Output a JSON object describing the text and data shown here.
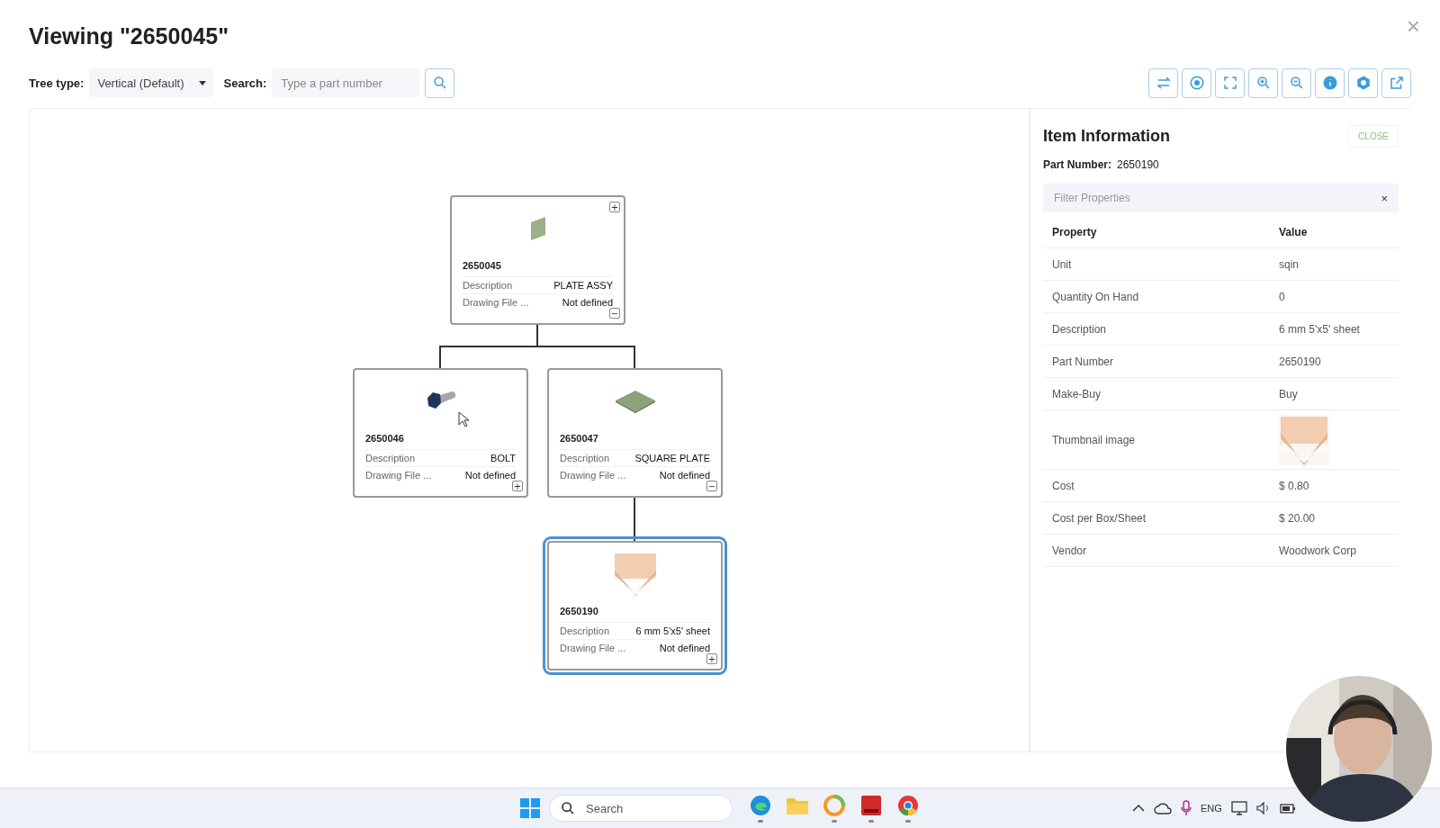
{
  "title": "Viewing \"2650045\"",
  "close_symbol": "×",
  "toolbar": {
    "tree_type_label": "Tree type:",
    "tree_type_value": "Vertical (Default)",
    "search_label": "Search:",
    "search_placeholder": "Type a part number",
    "buttons": [
      {
        "kind": "swap"
      },
      {
        "kind": "target"
      },
      {
        "kind": "fit"
      },
      {
        "kind": "zoom-in"
      },
      {
        "kind": "zoom-out"
      },
      {
        "kind": "info"
      },
      {
        "kind": "hexagon"
      },
      {
        "kind": "open"
      }
    ]
  },
  "tree": {
    "part_number": "2650045",
    "kind": "panel",
    "selected": false,
    "parent_toggle": "+",
    "toggle": "−",
    "fields": [
      {
        "label": "Description",
        "value": "PLATE ASSY"
      },
      {
        "label": "Drawing File ...",
        "value": "Not defined"
      }
    ],
    "children": [
      {
        "part_number": "2650046",
        "kind": "bolt",
        "selected": false,
        "toggle": "+",
        "fields": [
          {
            "label": "Description",
            "value": "BOLT"
          },
          {
            "label": "Drawing File ...",
            "value": "Not defined"
          }
        ]
      },
      {
        "part_number": "2650047",
        "kind": "plate",
        "selected": false,
        "toggle": "−",
        "fields": [
          {
            "label": "Description",
            "value": "SQUARE PLATE"
          },
          {
            "label": "Drawing File ...",
            "value": "Not defined"
          }
        ],
        "children": [
          {
            "part_number": "2650190",
            "kind": "sheet",
            "selected": true,
            "toggle": "+",
            "fields": [
              {
                "label": "Description",
                "value": "6 mm 5'x5' sheet"
              },
              {
                "label": "Drawing File ...",
                "value": "Not defined"
              }
            ]
          }
        ]
      }
    ]
  },
  "info_panel": {
    "title": "Item Information",
    "close_button": "CLOSE",
    "part_number_label": "Part Number:",
    "part_number": "2650190",
    "filter_placeholder": "Filter Properties",
    "filter_clear": "×",
    "columns": [
      "Property",
      "Value"
    ],
    "rows": [
      {
        "property": "Unit",
        "value": "sqin"
      },
      {
        "property": "Quantity On Hand",
        "value": "0"
      },
      {
        "property": "Description",
        "value": "6 mm 5'x5' sheet"
      },
      {
        "property": "Part Number",
        "value": "2650190"
      },
      {
        "property": "Make-Buy",
        "value": "Buy"
      },
      {
        "property": "Thumbnail image",
        "kind": "thumbnail"
      },
      {
        "property": "Cost",
        "value": "$ 0.80"
      },
      {
        "property": "Cost per Box/Sheet",
        "value": "$ 20.00"
      },
      {
        "property": "Vendor",
        "value": "Woodwork Corp"
      }
    ]
  },
  "taskbar": {
    "search_placeholder": "Search",
    "apps": [
      {
        "kind": "edge",
        "running": true
      },
      {
        "kind": "folder",
        "running": false
      },
      {
        "kind": "sync",
        "running": true
      },
      {
        "kind": "cad",
        "running": true
      },
      {
        "kind": "chrome",
        "running": true
      }
    ],
    "tray_language": "ENG"
  }
}
